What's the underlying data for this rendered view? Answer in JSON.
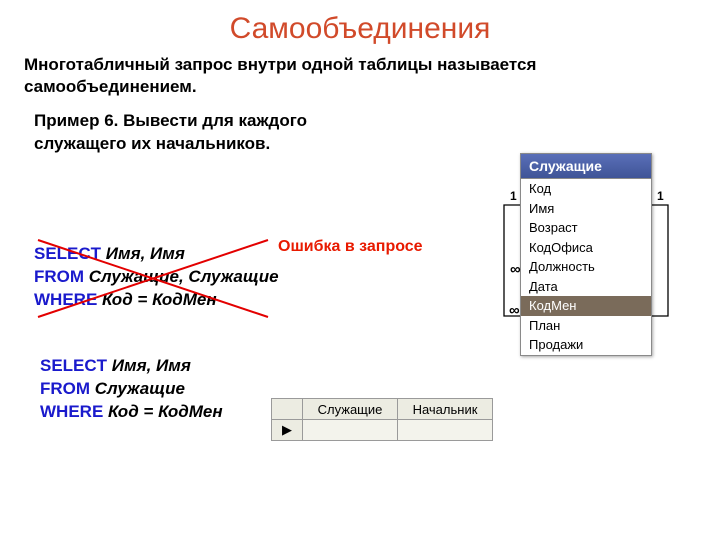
{
  "title": "Самообъединения",
  "subtitle": "Многотабличный запрос внутри одной таблицы называется самообъединением.",
  "example": "Пример 6. Вывести для каждого служащего их начальников.",
  "error_label": "Ошибка в запросе",
  "query1": {
    "l1_kw": "SELECT",
    "l1_id": " Имя, Имя",
    "l2_kw": "FROM",
    "l2_id": " Служащие, Служащие",
    "l3_kw": "WHERE",
    "l3_id": " Код = КодМен"
  },
  "query2": {
    "l1_kw": "SELECT",
    "l1_id": " Имя, Имя",
    "l2_kw": "FROM",
    "l2_id": " Служащие",
    "l3_kw": "WHERE",
    "l3_id": " Код = КодМен"
  },
  "table_window": {
    "title": "Служащие",
    "fields": [
      "Код",
      "Имя",
      "Возраст",
      "КодОфиса",
      "Должность",
      "Дата",
      "КодМен",
      "План",
      "Продажи"
    ],
    "selected_index": 6
  },
  "relations": {
    "left_top": "1",
    "left_bottom": "∞",
    "right_top": "1",
    "right_bottom": "∞"
  },
  "grid": {
    "col1": "Служащие",
    "col2": "Начальник",
    "row_marker": "▶"
  }
}
